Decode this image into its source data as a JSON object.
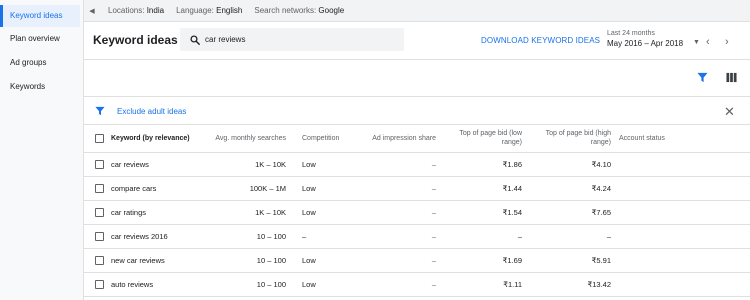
{
  "sidebar": {
    "items": [
      {
        "label": "Keyword ideas"
      },
      {
        "label": "Plan overview"
      },
      {
        "label": "Ad groups"
      },
      {
        "label": "Keywords"
      }
    ]
  },
  "topbar": {
    "location_label": "Locations:",
    "location_value": "India",
    "language_label": "Language:",
    "language_value": "English",
    "network_label": "Search networks:",
    "network_value": "Google"
  },
  "header": {
    "title": "Keyword ideas",
    "search_value": "car reviews",
    "download_label": "DOWNLOAD KEYWORD IDEAS",
    "date_label": "Last 24 months",
    "date_value": "May 2016 – Apr 2018"
  },
  "filter": {
    "text": "Exclude adult ideas"
  },
  "table": {
    "headers": {
      "keyword": "Keyword (by relevance)",
      "searches": "Avg. monthly searches",
      "competition": "Competition",
      "impression": "Ad impression share",
      "bid_low": "Top of page bid (low range)",
      "bid_high": "Top of page bid (high range)",
      "status": "Account status"
    },
    "rows": [
      {
        "keyword": "car reviews",
        "searches": "1K – 10K",
        "competition": "Low",
        "impression": "–",
        "bid_low": "₹1.86",
        "bid_high": "₹4.10",
        "status": ""
      },
      {
        "keyword": "compare cars",
        "searches": "100K – 1M",
        "competition": "Low",
        "impression": "–",
        "bid_low": "₹1.44",
        "bid_high": "₹4.24",
        "status": ""
      },
      {
        "keyword": "car ratings",
        "searches": "1K – 10K",
        "competition": "Low",
        "impression": "–",
        "bid_low": "₹1.54",
        "bid_high": "₹7.65",
        "status": ""
      },
      {
        "keyword": "car reviews 2016",
        "searches": "10 – 100",
        "competition": "–",
        "impression": "–",
        "bid_low": "–",
        "bid_high": "–",
        "status": ""
      },
      {
        "keyword": "new car reviews",
        "searches": "10 – 100",
        "competition": "Low",
        "impression": "–",
        "bid_low": "₹1.69",
        "bid_high": "₹5.91",
        "status": ""
      },
      {
        "keyword": "auto reviews",
        "searches": "10 – 100",
        "competition": "Low",
        "impression": "–",
        "bid_low": "₹1.11",
        "bid_high": "₹13.42",
        "status": ""
      }
    ]
  },
  "icons": {
    "collapse": "triangle-left-icon",
    "search": "search-icon",
    "dropdown": "triangle-down-icon",
    "prev": "chevron-left-icon",
    "next": "chevron-right-icon",
    "filter": "funnel-icon",
    "columns": "columns-icon",
    "close": "close-icon"
  },
  "colors": {
    "accent": "#1a73e8",
    "sidebar_bg": "#f8f9fa",
    "active_bg": "#e8f0fe"
  }
}
